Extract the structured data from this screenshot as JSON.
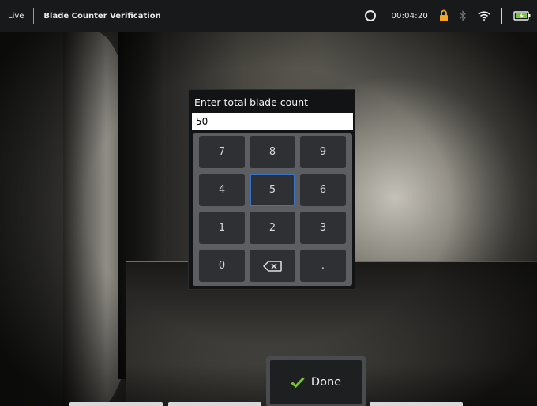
{
  "statusbar": {
    "mode": "Live",
    "title": "Blade Counter Verification",
    "time": "00:04:20"
  },
  "dialog": {
    "title": "Enter total blade count",
    "value": "50",
    "keys": [
      "7",
      "8",
      "9",
      "4",
      "5",
      "6",
      "1",
      "2",
      "3",
      "0",
      "",
      "."
    ],
    "selected_key": "5"
  },
  "done_button": {
    "label": "Done"
  },
  "colors": {
    "statusbar_bg": "#17191a",
    "lock": "#f5a623",
    "battery": "#7cc43a",
    "check": "#7cc43a",
    "selected_key_border": "#3a74c8"
  },
  "icons": {
    "status": [
      "sync-status-icon",
      "lock-icon",
      "bluetooth-icon",
      "wifi-icon",
      "battery-charging-icon"
    ],
    "keypad": [
      "backspace-icon"
    ],
    "done": [
      "checkmark-icon"
    ]
  }
}
